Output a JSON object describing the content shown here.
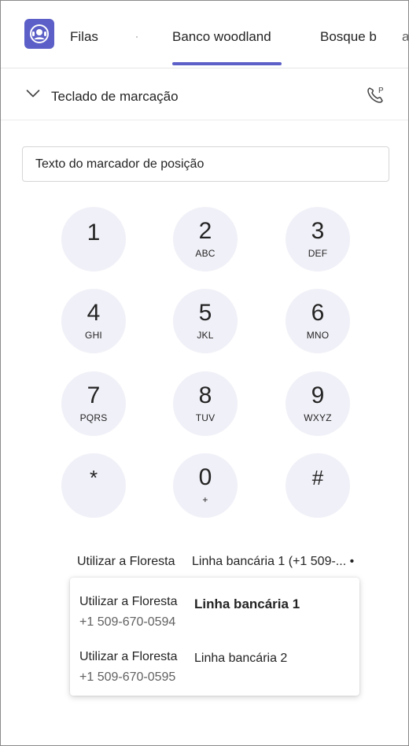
{
  "tabs": {
    "queues": "Filas",
    "bank": "Banco woodland",
    "forest": "Bosque b",
    "more": "a"
  },
  "dialpad": {
    "title": "Teclado de marcação"
  },
  "input": {
    "placeholder": "Texto do marcador de posição"
  },
  "keys": [
    {
      "digit": "1",
      "letters": ""
    },
    {
      "digit": "2",
      "letters": "ABC"
    },
    {
      "digit": "3",
      "letters": "DEF"
    },
    {
      "digit": "4",
      "letters": "GHI"
    },
    {
      "digit": "5",
      "letters": "JKL"
    },
    {
      "digit": "6",
      "letters": "MNO"
    },
    {
      "digit": "7",
      "letters": "PQRS"
    },
    {
      "digit": "8",
      "letters": "TUV"
    },
    {
      "digit": "9",
      "letters": "WXYZ"
    },
    {
      "digit": "*",
      "letters": ""
    },
    {
      "digit": "0",
      "letters": "+"
    },
    {
      "digit": "#",
      "letters": ""
    }
  ],
  "caller_id": {
    "name": "Utilizar a Floresta",
    "line": "Linha bancária 1 (+1 509-... •",
    "options": [
      {
        "name": "Utilizar a Floresta",
        "line": "Linha bancária 1",
        "number": "+1 509-670-0594"
      },
      {
        "name": "Utilizar a Floresta",
        "line": "Linha bancária 2",
        "number": "+1 509-670-0595"
      }
    ]
  },
  "colors": {
    "accent": "#5b5fc7",
    "key_background": "#f0f0f8"
  },
  "icons": {
    "app": "headset-person-icon",
    "collapse": "chevron-down-icon",
    "park": "phone-park-icon"
  }
}
